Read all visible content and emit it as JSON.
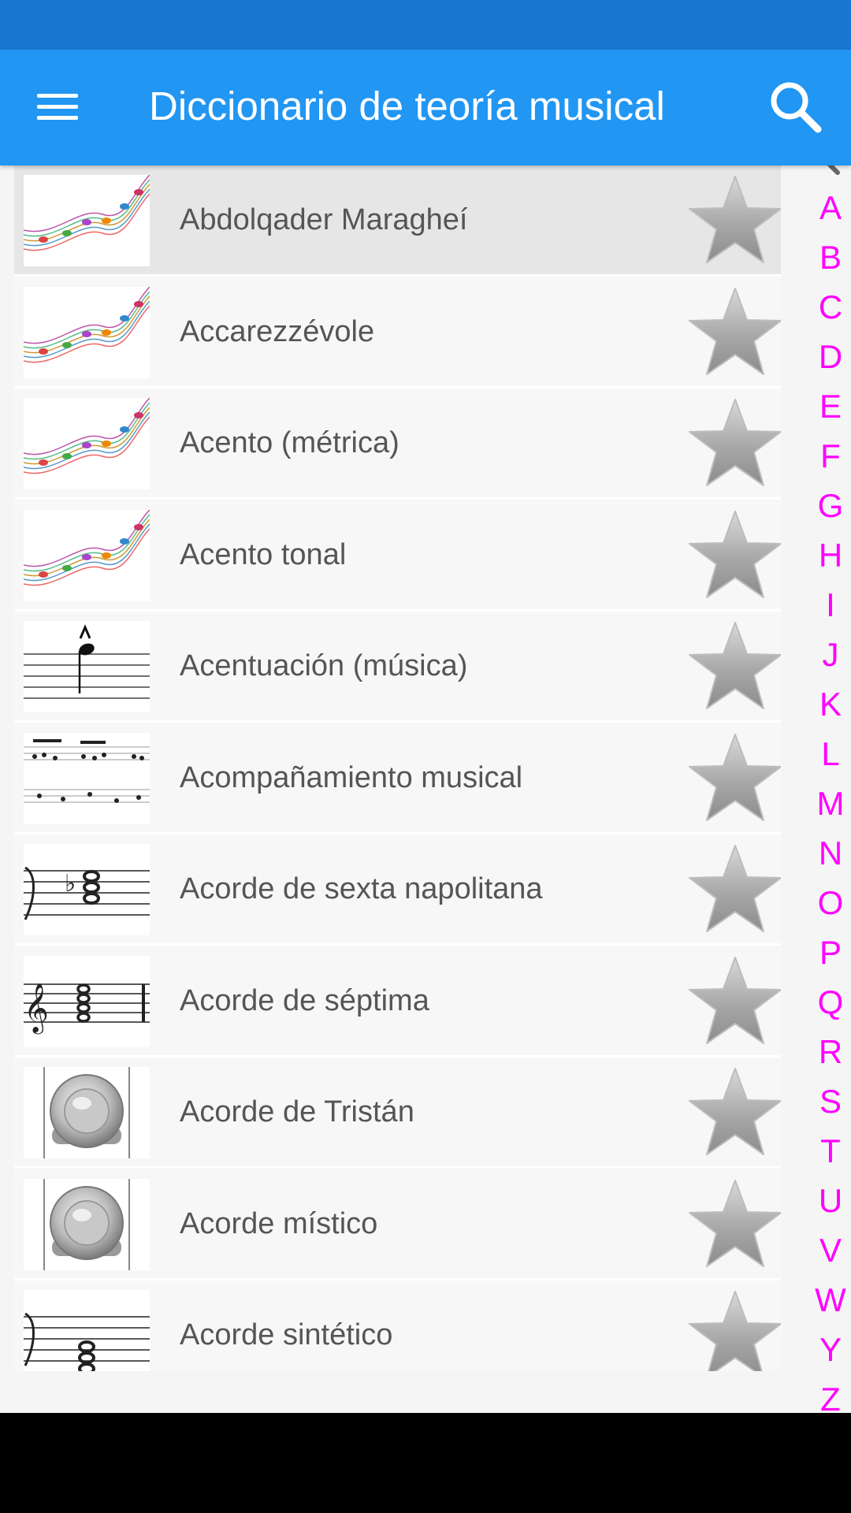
{
  "app": {
    "title": "Diccionario de teoría musical"
  },
  "colors": {
    "status_bar": "#1976D2",
    "app_bar": "#2196F3",
    "index_letters": "#FF00FF",
    "selected_row": "#e6e6e6"
  },
  "icons": {
    "menu": "menu-icon",
    "search": "search-icon",
    "favorite": "star-icon"
  },
  "entries": [
    {
      "label": "Abdolqader Maragheí",
      "thumb": "notes-swirl",
      "selected": true
    },
    {
      "label": "Accarezzévole",
      "thumb": "notes-swirl"
    },
    {
      "label": "Acento (métrica)",
      "thumb": "notes-swirl"
    },
    {
      "label": "Acento tonal",
      "thumb": "notes-swirl"
    },
    {
      "label": "Acentuación (música)",
      "thumb": "accent-note"
    },
    {
      "label": "Acompañamiento musical",
      "thumb": "score-excerpt"
    },
    {
      "label": "Acorde de sexta napolitana",
      "thumb": "chord-flat"
    },
    {
      "label": "Acorde de séptima",
      "thumb": "chord-treble"
    },
    {
      "label": "Acorde de Tristán",
      "thumb": "speaker"
    },
    {
      "label": "Acorde místico",
      "thumb": "speaker"
    },
    {
      "label": "Acorde sintético",
      "thumb": "chord-bass"
    }
  ],
  "alphabet": [
    "A",
    "B",
    "C",
    "D",
    "E",
    "F",
    "G",
    "H",
    "I",
    "J",
    "K",
    "L",
    "M",
    "N",
    "O",
    "P",
    "Q",
    "R",
    "S",
    "T",
    "U",
    "V",
    "W",
    "Y",
    "Z"
  ]
}
